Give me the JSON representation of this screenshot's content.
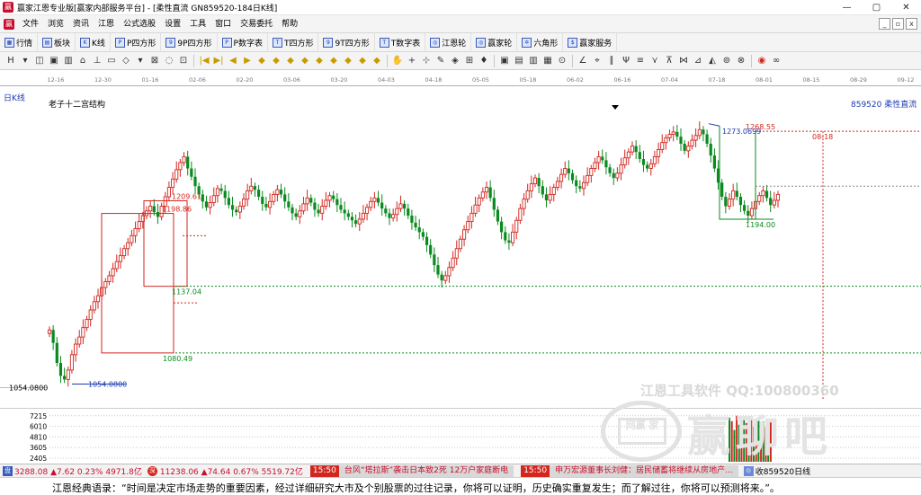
{
  "window": {
    "title": "赢家江恩专业版[赢家内部服务平台] - [柔性直流  GN859520-184日K线]",
    "app_icon": "赢",
    "controls": [
      "—",
      "▢",
      "✕"
    ]
  },
  "menu": {
    "logo": "赢",
    "items": [
      "文件",
      "浏览",
      "资讯",
      "江恩",
      "公式选股",
      "设置",
      "工具",
      "窗口",
      "交易委托",
      "帮助"
    ],
    "mdi_controls": [
      "_",
      "▫",
      "x"
    ]
  },
  "toolbar1": {
    "items": [
      {
        "icon": "grid-icon",
        "glyph": "▦",
        "label": "行情"
      },
      {
        "icon": "block-icon",
        "glyph": "▤",
        "label": "板块"
      },
      {
        "icon": "kline-icon",
        "glyph": "K",
        "label": "K线"
      },
      {
        "icon": "square-p-icon",
        "glyph": "P",
        "label": "P四方形"
      },
      {
        "icon": "square-9p-icon",
        "glyph": "9",
        "label": "9P四方形"
      },
      {
        "icon": "table-p-icon",
        "glyph": "P",
        "label": "P数字表"
      },
      {
        "icon": "square-t-icon",
        "glyph": "T",
        "label": "T四方形"
      },
      {
        "icon": "square-9t-icon",
        "glyph": "9",
        "label": "9T四方形"
      },
      {
        "icon": "table-t-icon",
        "glyph": "T",
        "label": "T数字表"
      },
      {
        "icon": "wheel-icon",
        "glyph": "◎",
        "label": "江恩轮"
      },
      {
        "icon": "winner-wheel-icon",
        "glyph": "◎",
        "label": "赢家轮"
      },
      {
        "icon": "hexagon-icon",
        "glyph": "✡",
        "label": "六角形"
      },
      {
        "icon": "service-icon",
        "glyph": "$",
        "label": "赢家服务"
      }
    ]
  },
  "toolbar2": {
    "groups": [
      [
        "H",
        "▾",
        "◫",
        "▣",
        "▥",
        "⌂",
        "⊥",
        "▭",
        "◇",
        "▾",
        "⊠",
        "◌",
        "⊡"
      ],
      [
        "|◀",
        "▶|",
        "◀",
        "▶",
        "◆",
        "◆",
        "◆",
        "◆",
        "◆",
        "◆",
        "◆",
        "◆",
        "◆"
      ],
      [
        "✋",
        "+",
        "⊹",
        "✎",
        "◈",
        "⊞",
        "♦"
      ],
      [
        "▣",
        "▤",
        "▥",
        "▦",
        "⊙"
      ],
      [
        "∠",
        "⌖",
        "∥",
        "Ψ",
        "≡",
        "⋎",
        "⊼",
        "⋈",
        "⊿",
        "◭",
        "⊚",
        "⊗"
      ],
      [
        "◉",
        "∞"
      ]
    ]
  },
  "chart": {
    "period_label": "日K线",
    "structure_label": "老子十二宫结构",
    "code": "859520",
    "name": "柔性直流",
    "dates": [
      "12-16",
      "12-30",
      "01-16",
      "02-06",
      "02-20",
      "03-06",
      "03-20",
      "04-03",
      "04-18",
      "05-05",
      "05-18",
      "06-02",
      "06-16",
      "07-04",
      "07-18",
      "08-01",
      "08-15",
      "08-29",
      "09-12"
    ],
    "price_ticks": [
      "1054.0800"
    ],
    "annotations": [
      "1268.55",
      "1273.0699",
      "1209.61",
      "1198.86",
      "1194.00",
      "1137.04",
      "1080.49",
      "1054.0800",
      "08-18"
    ],
    "volume_ticks": [
      "7215",
      "6010",
      "4810",
      "3605",
      "2405"
    ]
  },
  "chart_data": {
    "type": "candlestick",
    "title": "",
    "xlabel": "",
    "ylabel": "",
    "x_ticks": [
      "12-16",
      "12-30",
      "01-16",
      "02-06",
      "02-20",
      "03-06",
      "03-20",
      "04-03",
      "04-18",
      "05-05",
      "05-18",
      "06-02",
      "06-16",
      "07-04",
      "07-18",
      "08-01",
      "08-15",
      "08-29",
      "09-12"
    ],
    "ylim": [
      1040,
      1290
    ],
    "volume_ylim": [
      2000,
      7700
    ],
    "key_levels": [
      {
        "label": "1268.55",
        "value": 1268.55
      },
      {
        "label": "1273.0699",
        "value": 1273.0699
      },
      {
        "label": "1209.61",
        "value": 1209.61
      },
      {
        "label": "1198.86",
        "value": 1198.86
      },
      {
        "label": "1194.00",
        "value": 1194.0
      },
      {
        "label": "1137.04",
        "value": 1137.04
      },
      {
        "label": "1080.49",
        "value": 1080.49
      },
      {
        "label": "1054.0800",
        "value": 1054.08
      }
    ],
    "closes": [
      1100,
      1089,
      1072,
      1061,
      1058,
      1066,
      1079,
      1088,
      1094,
      1102,
      1109,
      1117,
      1124,
      1129,
      1136,
      1141,
      1146,
      1152,
      1158,
      1163,
      1169,
      1174,
      1180,
      1186,
      1192,
      1197,
      1201,
      1205,
      1200,
      1196,
      1205,
      1213,
      1221,
      1228,
      1236,
      1242,
      1247,
      1237,
      1230,
      1222,
      1215,
      1209,
      1204,
      1208,
      1214,
      1220,
      1218,
      1212,
      1206,
      1202,
      1200,
      1205,
      1211,
      1218,
      1222,
      1219,
      1213,
      1207,
      1204,
      1209,
      1215,
      1219,
      1215,
      1209,
      1204,
      1199,
      1196,
      1201,
      1207,
      1212,
      1208,
      1202,
      1199,
      1205,
      1210,
      1214,
      1211,
      1206,
      1202,
      1199,
      1196,
      1193,
      1190,
      1194,
      1199,
      1204,
      1209,
      1212,
      1208,
      1203,
      1199,
      1195,
      1198,
      1203,
      1207,
      1203,
      1197,
      1191,
      1187,
      1183,
      1179,
      1172,
      1164,
      1155,
      1147,
      1142,
      1146,
      1153,
      1161,
      1169,
      1177,
      1185,
      1192,
      1199,
      1206,
      1212,
      1217,
      1221,
      1212,
      1202,
      1192,
      1183,
      1176,
      1174,
      1183,
      1193,
      1203,
      1211,
      1218,
      1224,
      1229,
      1222,
      1215,
      1210,
      1215,
      1221,
      1226,
      1232,
      1237,
      1233,
      1227,
      1222,
      1220,
      1225,
      1231,
      1237,
      1242,
      1247,
      1244,
      1238,
      1233,
      1229,
      1233,
      1240,
      1246,
      1251,
      1256,
      1251,
      1245,
      1240,
      1237,
      1241,
      1247,
      1253,
      1259,
      1263,
      1266,
      1268,
      1264,
      1258,
      1252,
      1256,
      1261,
      1265,
      1270,
      1266,
      1258,
      1248,
      1237,
      1225,
      1213,
      1205,
      1211,
      1218,
      1213,
      1206,
      1201,
      1197,
      1203,
      1209,
      1214,
      1218,
      1212,
      1206,
      1210,
      1215
    ],
    "volume_spikes": [
      7000,
      6600,
      5600,
      7215,
      6200,
      4800,
      7100,
      6400,
      5200,
      6900,
      6000,
      5400,
      7000,
      4500,
      6600,
      5900,
      5200,
      6800
    ]
  },
  "watermark": {
    "line1": "江恩工具软件  QQ:100800360",
    "badge": "网赢\n家",
    "big": "赢聊吧"
  },
  "statusbar": {
    "icon": "盘",
    "index1": "3288.08 ▲7.62 0.23% 4971.8亿",
    "badge": "深",
    "index2": "11238.06 ▲74.64 0.67% 5519.72亿",
    "news": [
      {
        "time": "15:50",
        "text": "台风“塔拉斯”袭击日本致2死 12万户家庭断电"
      },
      {
        "time": "15:50",
        "text": "申万宏源董事长刘健：居民储蓄将继续从房地产..."
      }
    ],
    "end_icon": "⊙",
    "end_text": "收859520日线"
  },
  "quote": {
    "text": "江恩经典语录：“时间是决定市场走势的重要因素，经过详细研究大市及个别股票的过往记录，你将可以证明，历史确实重复发生；而了解过往，你将可以预测将来。”。"
  }
}
